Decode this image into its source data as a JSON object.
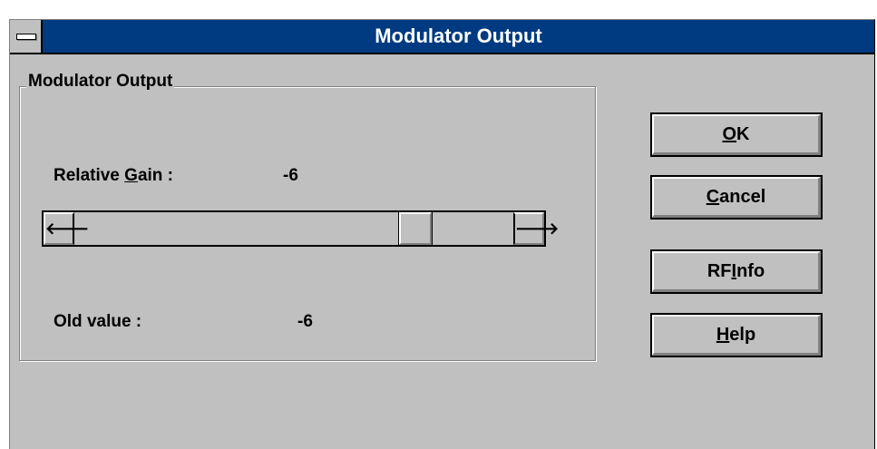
{
  "window": {
    "title": "Modulator Output"
  },
  "group": {
    "label": "Modulator Output",
    "relative_gain_label_pre": "Relative ",
    "relative_gain_label_key": "G",
    "relative_gain_label_post": "ain :",
    "relative_gain_value": "-6",
    "old_value_label": "Old value :",
    "old_value": "-6"
  },
  "slider": {
    "left_arrow": "🡐",
    "right_arrow": "🡒",
    "position_fraction": 0.8
  },
  "buttons": [
    {
      "key": "O",
      "rest": "K"
    },
    {
      "key": "C",
      "rest": "ancel"
    },
    {
      "pre": "RF ",
      "key": "I",
      "rest": "nfo"
    },
    {
      "key": "H",
      "rest": "elp"
    }
  ]
}
